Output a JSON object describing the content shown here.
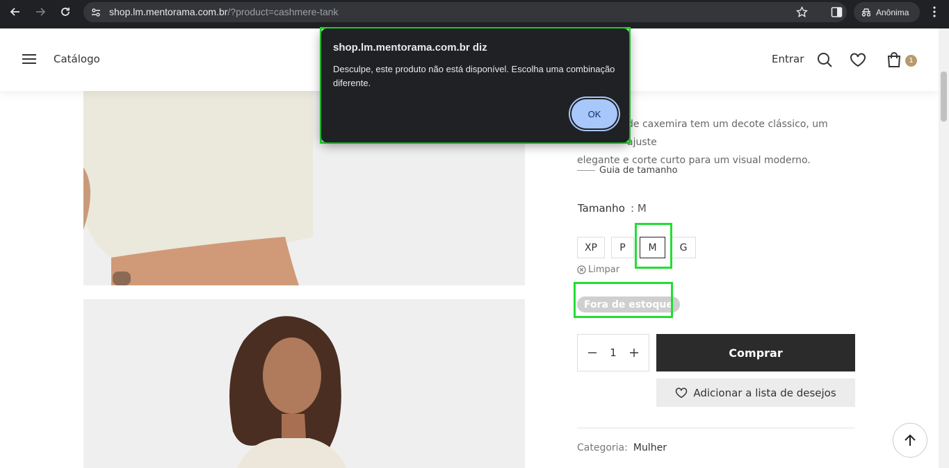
{
  "browser": {
    "url_host": "shop.lm.mentorama.com.br",
    "url_path": "/?product=cashmere-tank",
    "profile_label": "Anônima"
  },
  "header": {
    "menu_label": "Catálogo",
    "login_label": "Entrar",
    "cart_count": "1"
  },
  "product": {
    "description_line1": "de caxemira tem um decote clássico, um ajuste",
    "description_line2": "elegante e corte curto para um visual moderno.",
    "size_guide_label": "Guia de tamanho",
    "size_label": "Tamanho",
    "size_selected": ": M",
    "sizes": [
      "XP",
      "P",
      "M",
      "G"
    ],
    "clear_label": "Limpar",
    "stock_status": "Fora de estoque",
    "quantity": "1",
    "buy_label": "Comprar",
    "wishlist_label": "Adicionar a lista de desejos",
    "category_label": "Categoria:",
    "category_value": "Mulher"
  },
  "dialog": {
    "title": "shop.lm.mentorama.com.br diz",
    "message": "Desculpe, este produto não está disponível. Escolha uma combinação diferente.",
    "ok_label": "OK"
  },
  "colors": {
    "browser_bg": "#202124",
    "buy_button": "#2b2b2b",
    "cart_badge": "#b89b6a",
    "highlight": "#22dd33",
    "dialog_ok": "#a8c7fa"
  }
}
